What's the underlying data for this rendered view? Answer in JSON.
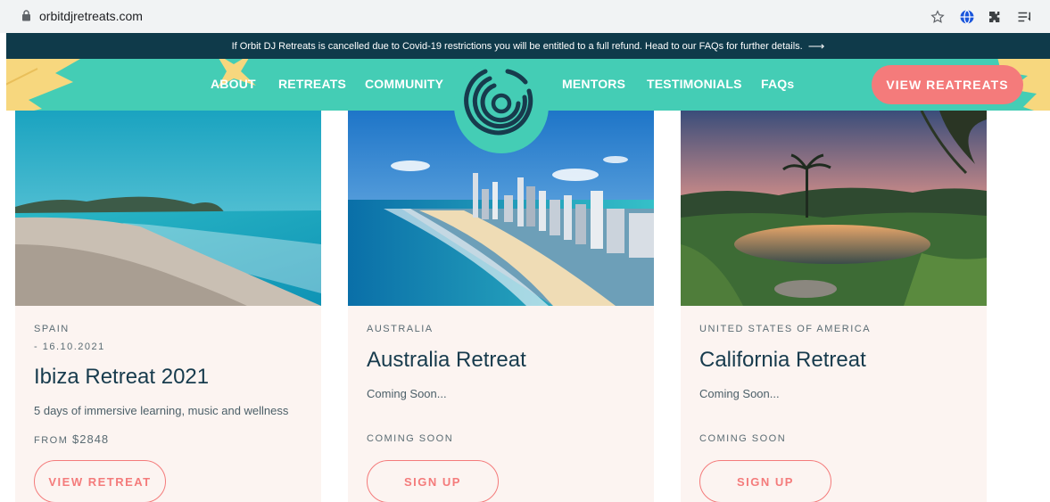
{
  "browser": {
    "url": "orbitdjretreats.com"
  },
  "banner": {
    "text": "If Orbit DJ Retreats is cancelled due to Covid-19 restrictions you will be entitled to a full refund. Head to our FAQs for further details.",
    "arrow": "⟶"
  },
  "nav": {
    "items": [
      {
        "label": "ABOUT"
      },
      {
        "label": "RETREATS"
      },
      {
        "label": "COMMUNITY"
      },
      {
        "label": "MENTORS"
      },
      {
        "label": "TESTIMONIALS"
      },
      {
        "label": "FAQs"
      }
    ],
    "cta_label": "VIEW REATREATS"
  },
  "cards": [
    {
      "country": "SPAIN",
      "date": "- 16.10.2021",
      "title": "Ibiza Retreat 2021",
      "description": "5 days of immersive learning, music and wellness",
      "price_prefix": "FROM",
      "price": "$2848",
      "button": "VIEW RETREAT"
    },
    {
      "country": "AUSTRALIA",
      "title": "Australia Retreat",
      "description": "Coming Soon...",
      "status": "COMING SOON",
      "button": "SIGN UP"
    },
    {
      "country": "UNITED STATES OF AMERICA",
      "title": "California Retreat",
      "description": "Coming Soon...",
      "status": "COMING SOON",
      "button": "SIGN UP"
    }
  ],
  "colors": {
    "teal": "#44cdb5",
    "navy": "#0f3a4a",
    "coral": "#f47b7b",
    "card_bg": "#fcf4f1"
  }
}
